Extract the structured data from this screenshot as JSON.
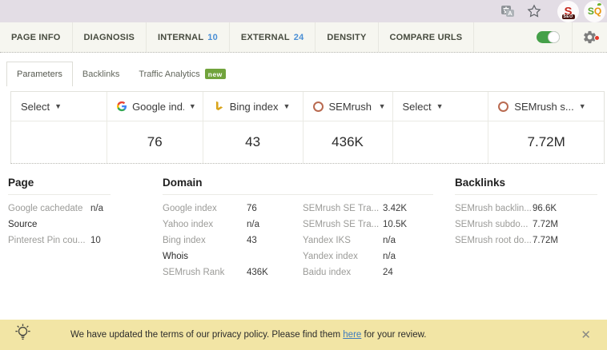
{
  "browser_bar": {
    "seo_ext_letter": "S",
    "seo_ext_band": "SEO",
    "sq_ext_s": "S",
    "sq_ext_q": "Q"
  },
  "nav": {
    "items": [
      {
        "label": "PAGE INFO"
      },
      {
        "label": "DIAGNOSIS"
      },
      {
        "label": "INTERNAL",
        "count": "10"
      },
      {
        "label": "EXTERNAL",
        "count": "24"
      },
      {
        "label": "DENSITY"
      },
      {
        "label": "COMPARE URLS"
      }
    ]
  },
  "tabs": {
    "items": [
      {
        "label": "Parameters",
        "active": true
      },
      {
        "label": "Backlinks"
      },
      {
        "label": "Traffic Analytics",
        "badge": "new"
      }
    ]
  },
  "table": {
    "columns": [
      {
        "icon": "none",
        "label": "Select",
        "value": ""
      },
      {
        "icon": "google",
        "label": "Google ind...",
        "value": "76"
      },
      {
        "icon": "bing",
        "label": "Bing index",
        "value": "43"
      },
      {
        "icon": "semrush",
        "label": "SEMrush ...",
        "value": "436K"
      },
      {
        "icon": "none",
        "label": "Select",
        "value": ""
      },
      {
        "icon": "semrush",
        "label": "SEMrush s...",
        "value": "7.72M"
      }
    ]
  },
  "sections": {
    "page": {
      "title": "Page",
      "rows": [
        {
          "label": "Google cachedate",
          "value": "n/a"
        },
        {
          "label": "Source",
          "value": "",
          "link": true
        },
        {
          "label": "Pinterest Pin cou...",
          "value": "10"
        }
      ]
    },
    "domain": {
      "title": "Domain",
      "col1": [
        {
          "label": "Google index",
          "value": "76"
        },
        {
          "label": "Yahoo index",
          "value": "n/a"
        },
        {
          "label": "Bing index",
          "value": "43"
        },
        {
          "label": "Whois",
          "value": "",
          "link": true
        },
        {
          "label": "SEMrush Rank",
          "value": "436K"
        }
      ],
      "col2": [
        {
          "label": "SEMrush SE Tra...",
          "value": "3.42K"
        },
        {
          "label": "SEMrush SE Tra...",
          "value": "10.5K"
        },
        {
          "label": "Yandex IKS",
          "value": "n/a"
        },
        {
          "label": "Yandex index",
          "value": "n/a"
        },
        {
          "label": "Baidu index",
          "value": "24"
        }
      ]
    },
    "backlinks": {
      "title": "Backlinks",
      "rows": [
        {
          "label": "SEMrush backlin...",
          "value": "96.6K"
        },
        {
          "label": "SEMrush subdo...",
          "value": "7.72M"
        },
        {
          "label": "SEMrush root do...",
          "value": "7.72M"
        }
      ]
    }
  },
  "privacy": {
    "text_before": "We have updated the terms of our privacy policy. Please find them ",
    "link_text": "here",
    "text_after": " for your review.",
    "close_label": "✕"
  },
  "colors": {
    "toggle_green": "#45A049",
    "badge_green": "#71A33C",
    "count_blue": "#4A8FD5",
    "notice_bg": "#F2E5A5",
    "link_blue": "#3E7BBE",
    "chrome_bar": "#E3DDE5"
  }
}
